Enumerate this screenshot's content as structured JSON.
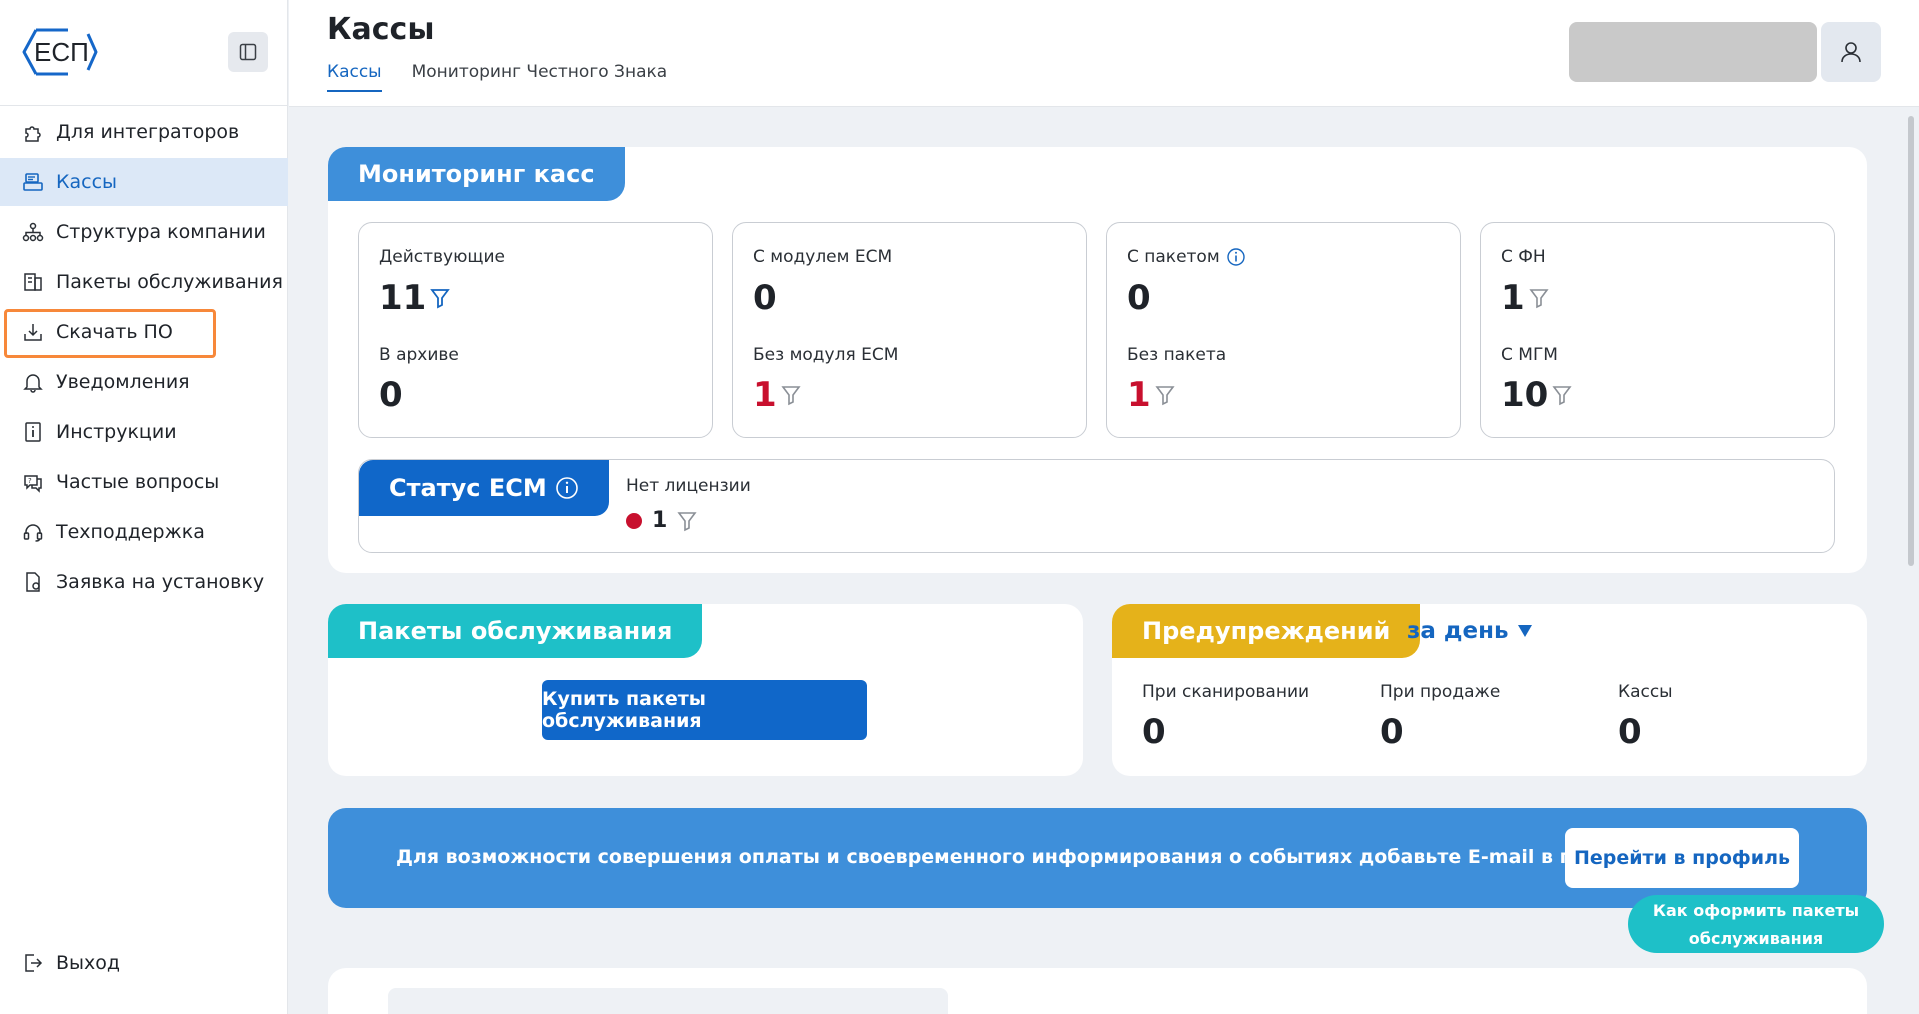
{
  "logo": {
    "text": "ЕСП"
  },
  "sidebar": {
    "items": [
      {
        "label": "Для интеграторов",
        "icon": "puzzle-icon"
      },
      {
        "label": "Кассы",
        "icon": "cash-register-icon",
        "active": true
      },
      {
        "label": "Структура компании",
        "icon": "org-structure-icon"
      },
      {
        "label": "Пакеты обслуживания",
        "icon": "package-icon"
      },
      {
        "label": "Скачать ПО",
        "icon": "download-icon"
      },
      {
        "label": "Уведомления",
        "icon": "bell-icon"
      },
      {
        "label": "Инструкции",
        "icon": "info-document-icon"
      },
      {
        "label": "Частые вопросы",
        "icon": "faq-icon"
      },
      {
        "label": "Техподдержка",
        "icon": "headset-icon"
      },
      {
        "label": "Заявка на установку",
        "icon": "install-request-icon"
      }
    ],
    "logout": "Выход"
  },
  "header": {
    "title": "Кассы",
    "tabs": [
      "Кассы",
      "Мониторинг Честного Знака"
    ]
  },
  "monitoring": {
    "title": "Мониторинг касс",
    "cards": [
      {
        "label1": "Действующие",
        "value1": "11",
        "label2": "В архиве",
        "value2": "0"
      },
      {
        "label1": "С модулем ECM",
        "value1": "0",
        "label2": "Без модуля ECM",
        "value2": "1"
      },
      {
        "label1": "С пакетом",
        "value1": "0",
        "label2": "Без пакета",
        "value2": "1"
      },
      {
        "label1": "С ФН",
        "value1": "1",
        "label2": "С МГМ",
        "value2": "10"
      }
    ],
    "ecm_status": {
      "title": "Статус ECM",
      "label": "Нет лицензии",
      "value": "1",
      "dot_color": "#c8102e"
    }
  },
  "packages": {
    "title": "Пакеты обслуживания",
    "button": "Купить пакеты обслуживания"
  },
  "warnings": {
    "title": "Предупреждений",
    "period": "за день",
    "columns": [
      {
        "label": "При сканировании",
        "value": "0"
      },
      {
        "label": "При продаже",
        "value": "0"
      },
      {
        "label": "Кассы",
        "value": "0"
      }
    ]
  },
  "banner": {
    "text": "Для возможности совершения оплаты и своевременного информирования о событиях добавьте E-mail в профиле.",
    "button": "Перейти в профиль"
  },
  "help_pill": {
    "line1": "Как оформить пакеты",
    "line2": "обслуживания"
  },
  "colors": {
    "accent": "#1067c9",
    "teal": "#1ec0c8",
    "yellow": "#e5b21a",
    "red": "#c8102e",
    "highlight": "#f7883a"
  }
}
